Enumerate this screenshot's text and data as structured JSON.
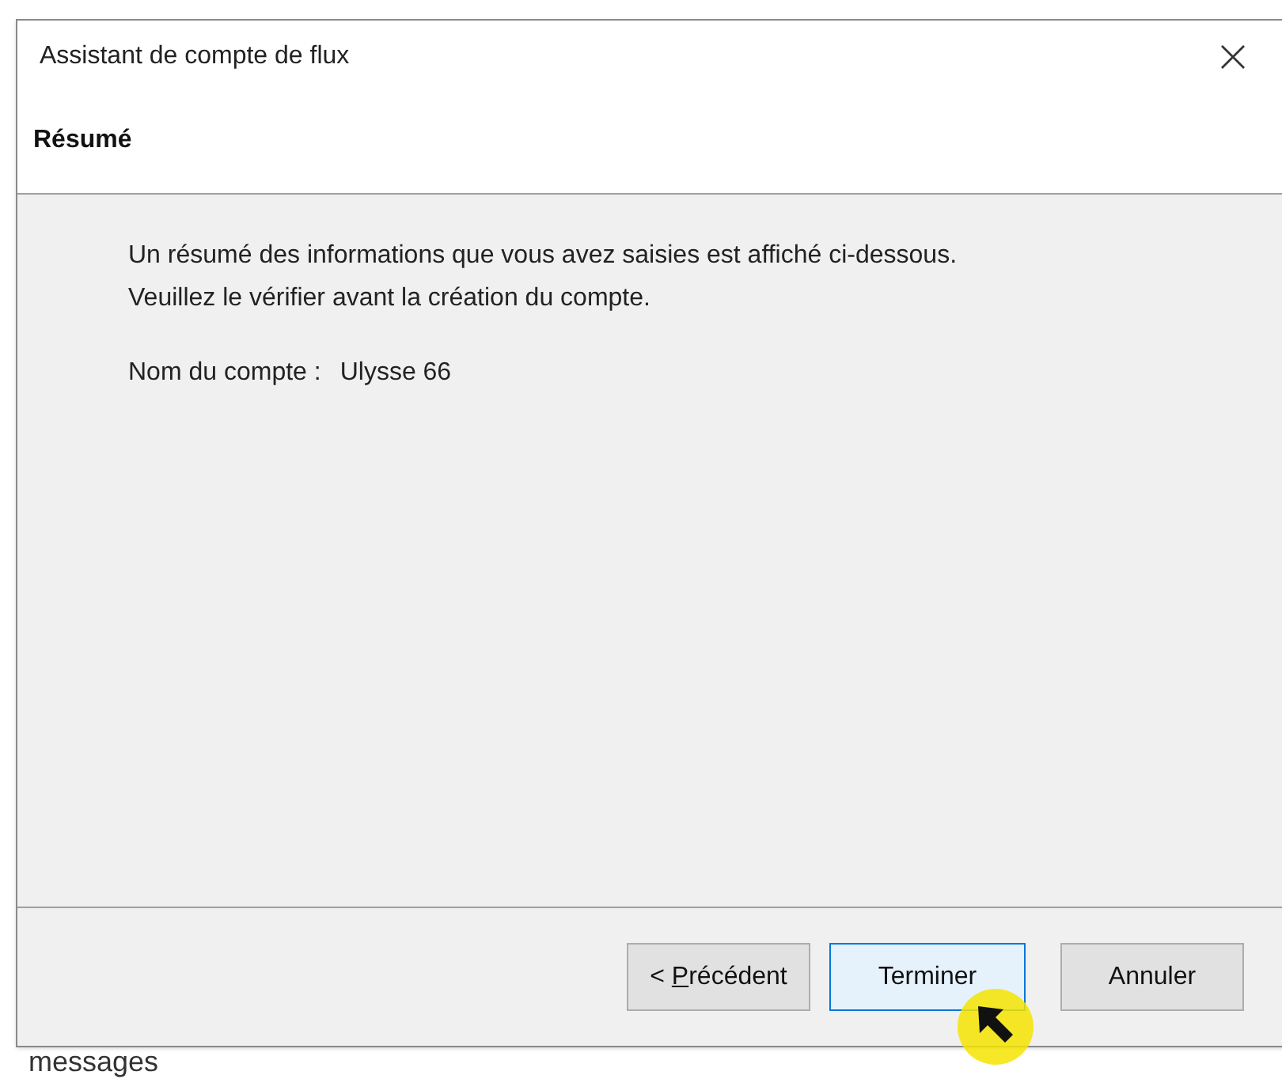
{
  "window": {
    "title": "Assistant de compte de flux"
  },
  "page_header": {
    "title": "Résumé"
  },
  "body": {
    "intro": "Un résumé des informations que vous avez saisies est affiché ci-dessous.\nVeuillez le vérifier avant la création du compte.",
    "fields": [
      {
        "label": "Nom du compte :",
        "value": "Ulysse 66"
      }
    ]
  },
  "buttons": [
    {
      "prefix": "< ",
      "mnemonic": "P",
      "rest": "récédent",
      "focused": false
    },
    {
      "rest": "Terminer",
      "focused": true
    },
    {
      "rest": "Annuler",
      "focused": false
    }
  ],
  "background": {
    "text": "messages"
  }
}
